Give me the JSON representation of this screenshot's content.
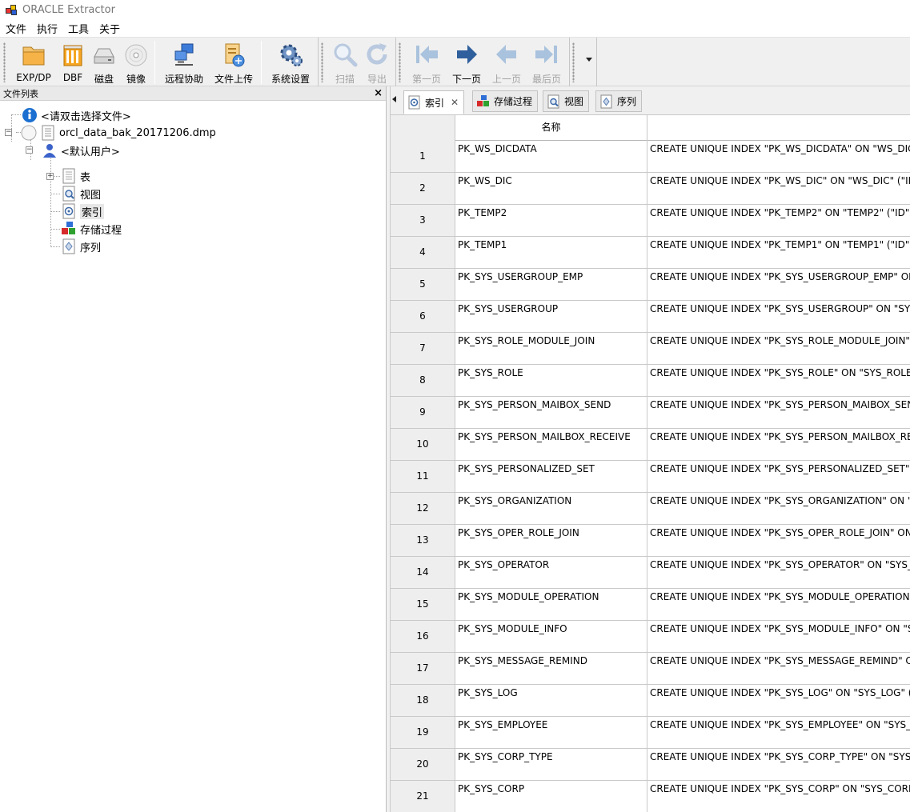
{
  "window": {
    "title": "ORACLE Extractor"
  },
  "menu": [
    "文件",
    "执行",
    "工具",
    "关于"
  ],
  "toolbar": {
    "buttons": [
      {
        "label": "EXP/DP",
        "icon": "folder-icon",
        "enabled": true
      },
      {
        "label": "DBF",
        "icon": "dbf-file-icon",
        "enabled": true
      },
      {
        "label": "磁盘",
        "icon": "disk-icon",
        "enabled": true
      },
      {
        "label": "镜像",
        "icon": "disc-image-icon",
        "enabled": true
      },
      {
        "label": "远程协助",
        "icon": "remote-assist-icon",
        "enabled": true
      },
      {
        "label": "文件上传",
        "icon": "file-upload-icon",
        "enabled": true
      },
      {
        "label": "系统设置",
        "icon": "settings-gear-icon",
        "enabled": true
      },
      {
        "label": "扫描",
        "icon": "scan-magnifier-icon",
        "enabled": false
      },
      {
        "label": "导出",
        "icon": "export-refresh-icon",
        "enabled": false
      },
      {
        "label": "第一页",
        "icon": "first-page-icon",
        "enabled": false
      },
      {
        "label": "下一页",
        "icon": "next-page-arrow-icon",
        "enabled": true
      },
      {
        "label": "上一页",
        "icon": "prev-page-arrow-icon",
        "enabled": false
      },
      {
        "label": "最后页",
        "icon": "last-page-icon",
        "enabled": false
      }
    ]
  },
  "file_panel": {
    "title": "文件列表",
    "close": "×",
    "tree": {
      "hint": "<请双击选择文件>",
      "file": "orcl_data_bak_20171206.dmp",
      "user": "<默认用户>",
      "children": [
        "表",
        "视图",
        "索引",
        "存储过程",
        "序列"
      ],
      "selected": "索引"
    }
  },
  "tabs": [
    {
      "label": "索引",
      "icon": "index-icon",
      "active": true,
      "closable": true
    },
    {
      "label": "存储过程",
      "icon": "stored-procedure-icon",
      "active": false,
      "closable": false
    },
    {
      "label": "视图",
      "icon": "view-icon",
      "active": false,
      "closable": false
    },
    {
      "label": "序列",
      "icon": "sequence-icon",
      "active": false,
      "closable": false
    }
  ],
  "tab_close": "✕",
  "grid": {
    "columns": [
      "",
      "名称",
      ""
    ],
    "rows": [
      {
        "n": "1",
        "name": "PK_WS_DICDATA",
        "ddl": "CREATE UNIQUE INDEX \"PK_WS_DICDATA\" ON \"WS_DIC"
      },
      {
        "n": "2",
        "name": "PK_WS_DIC",
        "ddl": "CREATE UNIQUE INDEX \"PK_WS_DIC\" ON \"WS_DIC\" (\"ID"
      },
      {
        "n": "3",
        "name": "PK_TEMP2",
        "ddl": "CREATE UNIQUE INDEX \"PK_TEMP2\" ON \"TEMP2\" (\"ID\""
      },
      {
        "n": "4",
        "name": "PK_TEMP1",
        "ddl": "CREATE UNIQUE INDEX \"PK_TEMP1\" ON \"TEMP1\" (\"ID\""
      },
      {
        "n": "5",
        "name": "PK_SYS_USERGROUP_EMP",
        "ddl": "CREATE UNIQUE INDEX \"PK_SYS_USERGROUP_EMP\" ON"
      },
      {
        "n": "6",
        "name": "PK_SYS_USERGROUP",
        "ddl": "CREATE UNIQUE INDEX \"PK_SYS_USERGROUP\" ON \"SYS"
      },
      {
        "n": "7",
        "name": "PK_SYS_ROLE_MODULE_JOIN",
        "ddl": "CREATE UNIQUE INDEX \"PK_SYS_ROLE_MODULE_JOIN\""
      },
      {
        "n": "8",
        "name": "PK_SYS_ROLE",
        "ddl": "CREATE UNIQUE INDEX \"PK_SYS_ROLE\" ON \"SYS_ROLE\""
      },
      {
        "n": "9",
        "name": "PK_SYS_PERSON_MAIBOX_SEND",
        "ddl": "CREATE UNIQUE INDEX \"PK_SYS_PERSON_MAIBOX_SEN"
      },
      {
        "n": "10",
        "name": "PK_SYS_PERSON_MAILBOX_RECEIVE",
        "ddl": "CREATE UNIQUE INDEX \"PK_SYS_PERSON_MAILBOX_RE"
      },
      {
        "n": "11",
        "name": "PK_SYS_PERSONALIZED_SET",
        "ddl": "CREATE UNIQUE INDEX \"PK_SYS_PERSONALIZED_SET\" O"
      },
      {
        "n": "12",
        "name": "PK_SYS_ORGANIZATION",
        "ddl": "CREATE UNIQUE INDEX \"PK_SYS_ORGANIZATION\" ON \""
      },
      {
        "n": "13",
        "name": "PK_SYS_OPER_ROLE_JOIN",
        "ddl": "CREATE UNIQUE INDEX \"PK_SYS_OPER_ROLE_JOIN\" ON"
      },
      {
        "n": "14",
        "name": "PK_SYS_OPERATOR",
        "ddl": "CREATE UNIQUE INDEX \"PK_SYS_OPERATOR\" ON \"SYS_"
      },
      {
        "n": "15",
        "name": "PK_SYS_MODULE_OPERATION",
        "ddl": "CREATE UNIQUE INDEX \"PK_SYS_MODULE_OPERATION"
      },
      {
        "n": "16",
        "name": "PK_SYS_MODULE_INFO",
        "ddl": "CREATE UNIQUE INDEX \"PK_SYS_MODULE_INFO\" ON \"S"
      },
      {
        "n": "17",
        "name": "PK_SYS_MESSAGE_REMIND",
        "ddl": "CREATE UNIQUE INDEX \"PK_SYS_MESSAGE_REMIND\" O"
      },
      {
        "n": "18",
        "name": "PK_SYS_LOG",
        "ddl": "CREATE UNIQUE INDEX \"PK_SYS_LOG\" ON \"SYS_LOG\" (\""
      },
      {
        "n": "19",
        "name": "PK_SYS_EMPLOYEE",
        "ddl": "CREATE UNIQUE INDEX \"PK_SYS_EMPLOYEE\" ON \"SYS_E"
      },
      {
        "n": "20",
        "name": "PK_SYS_CORP_TYPE",
        "ddl": "CREATE UNIQUE INDEX \"PK_SYS_CORP_TYPE\" ON \"SYS_"
      },
      {
        "n": "21",
        "name": "PK_SYS_CORP",
        "ddl": "CREATE UNIQUE INDEX \"PK_SYS_CORP\" ON \"SYS_CORP"
      }
    ]
  },
  "colors": {
    "toolbar_bg": "#f0f0f0",
    "next_arrow": "#2f5f9c",
    "disabled_arrow": "#a9c2dd",
    "info_blue": "#1a6fd0",
    "selection_bg": "#e7e7e7"
  }
}
